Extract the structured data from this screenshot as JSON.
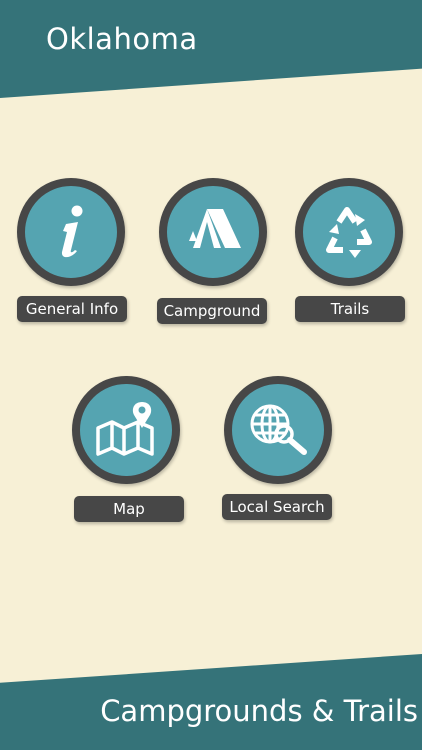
{
  "header": {
    "title": "Oklahoma"
  },
  "menu": {
    "general_info": {
      "label": "General Info",
      "icon": "info-icon"
    },
    "campground": {
      "label": "Campground",
      "icon": "tent-icon"
    },
    "trails": {
      "label": "Trails",
      "icon": "recycle-icon"
    },
    "map": {
      "label": "Map",
      "icon": "map-pin-icon"
    },
    "local_search": {
      "label": "Local Search",
      "icon": "globe-search-icon"
    }
  },
  "footer": {
    "title": "Campgrounds & Trails"
  },
  "colors": {
    "background": "#f7f0d6",
    "band": "#357379",
    "circle_fill": "#55a4b1",
    "dark": "#474747"
  }
}
